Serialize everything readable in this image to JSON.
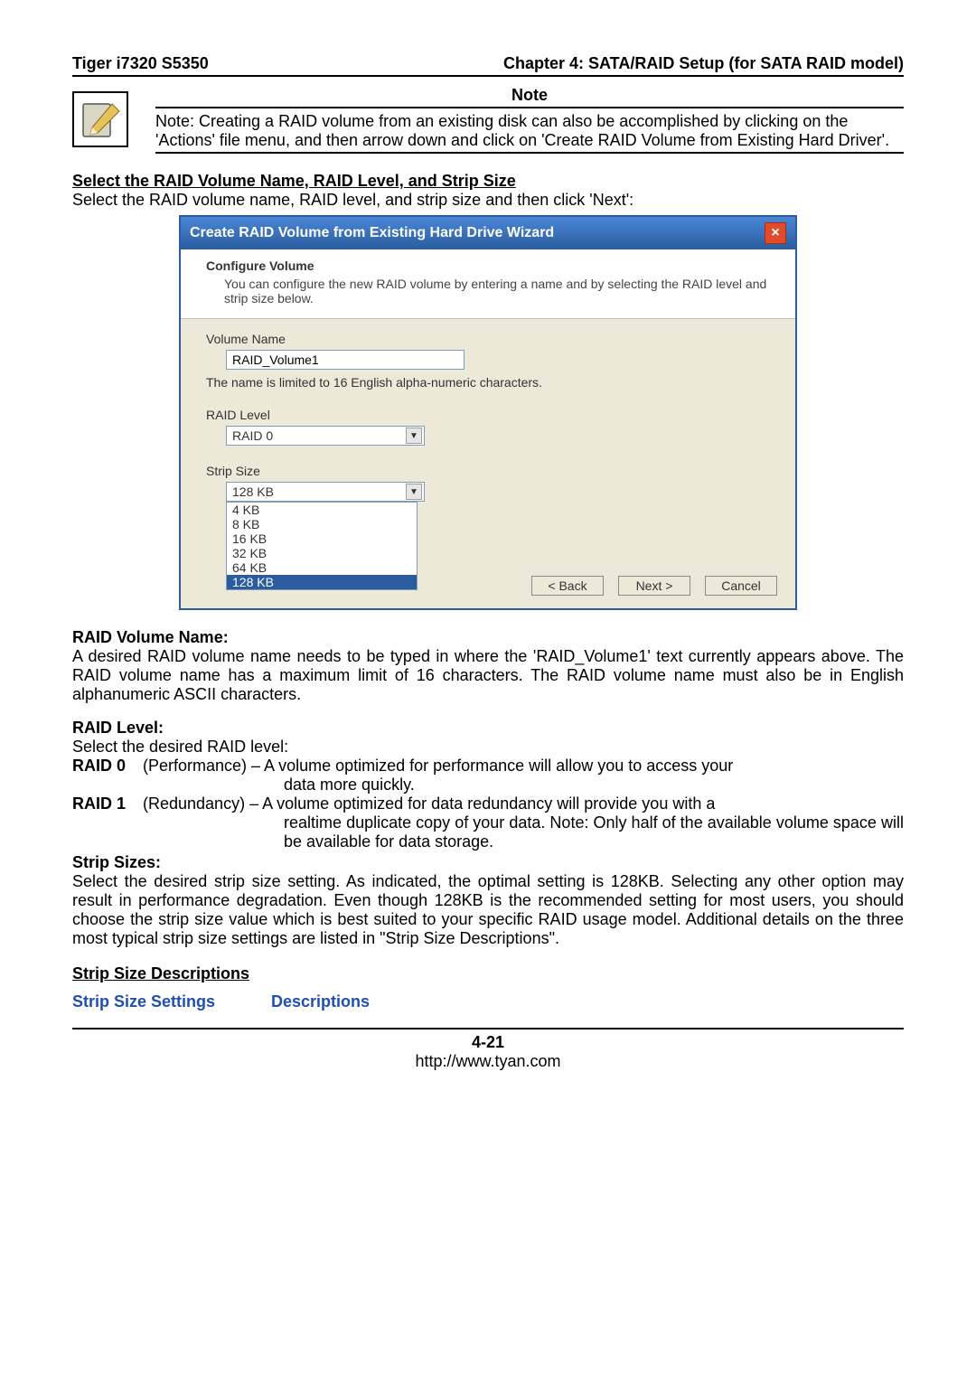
{
  "header": {
    "left": "Tiger i7320 S5350",
    "right": "Chapter 4: SATA/RAID Setup (for SATA RAID model)"
  },
  "note": {
    "title": "Note",
    "text": "Note: Creating a RAID volume from an existing disk can also be accomplished by clicking on the 'Actions' file menu, and then arrow down and click on 'Create RAID Volume from Existing Hard Driver'."
  },
  "section1": {
    "heading": "Select the RAID Volume Name, RAID Level, and Strip Size",
    "intro": "Select the RAID volume name, RAID level, and strip size and then click 'Next':"
  },
  "wizard": {
    "title": "Create RAID Volume from Existing Hard Drive Wizard",
    "header_title": "Configure Volume",
    "header_desc": "You can configure the new RAID volume by entering a name and by selecting the RAID level and strip size below.",
    "volume_label": "Volume Name",
    "volume_value": "RAID_Volume1",
    "volume_hint": "The name is limited to 16 English alpha-numeric characters.",
    "raid_label": "RAID Level",
    "raid_value": "RAID 0",
    "strip_label": "Strip Size",
    "strip_selected": "128 KB",
    "strip_options": [
      "4 KB",
      "8 KB",
      "16 KB",
      "32 KB",
      "64 KB",
      "128 KB"
    ],
    "btn_back": "< Back",
    "btn_next": "Next >",
    "btn_cancel": "Cancel"
  },
  "raid_volume_name": {
    "heading": "RAID Volume Name:",
    "text": "A desired RAID volume name needs to be typed in where the 'RAID_Volume1' text currently appears above. The RAID volume name has a maximum limit of 16 characters. The RAID volume name must also be in English alphanumeric ASCII characters."
  },
  "raid_level": {
    "heading": "RAID Level:",
    "intro": "Select the desired RAID level:",
    "r0_label": "RAID 0",
    "r0_text": "(Performance) – A volume optimized for performance will allow you to access your",
    "r0_cont": "data more quickly.",
    "r1_label": "RAID 1",
    "r1_text": "(Redundancy) – A volume optimized for data redundancy will provide you with a",
    "r1_cont": "realtime duplicate copy of your data. Note: Only half of the available volume space will be available for data storage."
  },
  "strip_sizes": {
    "heading": "Strip Sizes:",
    "text": "Select the desired strip size setting. As indicated, the optimal setting is 128KB. Selecting any other option may result in performance degradation. Even though 128KB is the recommended setting for most users, you should choose the strip size value which is best suited to your specific RAID usage model. Additional details on the three most typical strip size settings are listed in \"Strip Size Descriptions\"."
  },
  "strip_desc_heading": "Strip Size Descriptions",
  "table_head": {
    "c1": "Strip Size Settings",
    "c2": "Descriptions"
  },
  "footer": {
    "page": "4-21",
    "url": "http://www.tyan.com"
  }
}
